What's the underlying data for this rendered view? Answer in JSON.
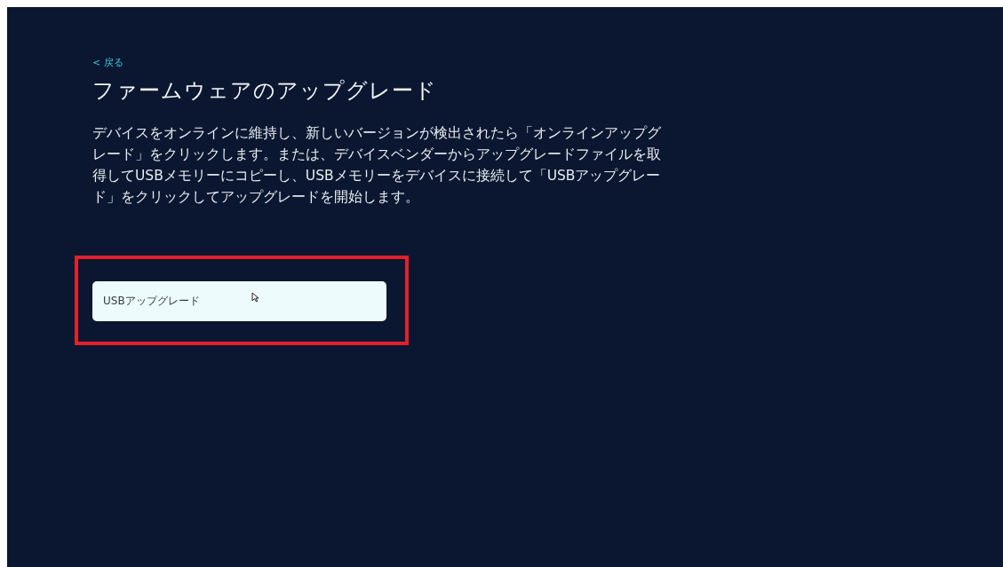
{
  "back_link": {
    "label": "< 戻る"
  },
  "title": "ファームウェアのアップグレード",
  "description": "デバイスをオンラインに維持し、新しいバージョンが検出されたら「オンラインアップグレード」をクリックします。または、デバイスベンダーからアップグレードファイルを取得してUSBメモリーにコピーし、USBメモリーをデバイスに接続して「USBアップグレード」をクリックしてアップグレードを開始します。",
  "buttons": [
    {
      "label": "USBアップグレード",
      "highlighted": true
    }
  ]
}
